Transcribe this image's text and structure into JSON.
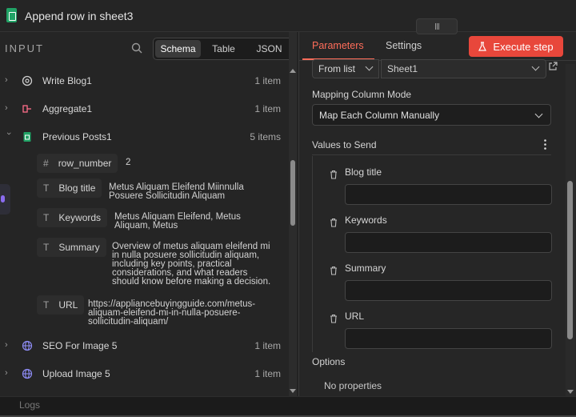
{
  "window": {
    "title": "Append row in sheet3"
  },
  "input_panel": {
    "label": "INPUT",
    "view_tabs": [
      {
        "label": "Schema",
        "active": true
      },
      {
        "label": "Table",
        "active": false
      },
      {
        "label": "JSON",
        "active": false
      }
    ],
    "nodes": [
      {
        "name": "Write Blog1",
        "count": "1 item",
        "icon": "openai-icon",
        "expanded": false
      },
      {
        "name": "Aggregate1",
        "count": "1 item",
        "icon": "aggregate-icon",
        "expanded": false
      },
      {
        "name": "Previous Posts1",
        "count": "5 items",
        "icon": "google-sheets-icon",
        "expanded": true
      },
      {
        "name": "SEO For Image 5",
        "count": "1 item",
        "icon": "globe-icon",
        "expanded": false
      },
      {
        "name": "Upload Image 5",
        "count": "1 item",
        "icon": "globe-icon",
        "expanded": false
      }
    ],
    "fields": [
      {
        "type": "#",
        "name": "row_number",
        "value": "2"
      },
      {
        "type": "T",
        "name": "Blog title",
        "value": "Metus Aliquam Eleifend Miinnulla\nPosuere Sollicitudin Aliquam"
      },
      {
        "type": "T",
        "name": "Keywords",
        "value": "Metus Aliquam Eleifend, Metus\nAliquam, Metus"
      },
      {
        "type": "T",
        "name": "Summary",
        "value": "Overview of metus aliquam eleifend mi\nin nulla posuere sollicitudin aliquam,\nincluding key points, practical\nconsiderations, and what readers\nshould know before making a decision."
      },
      {
        "type": "T",
        "name": "URL",
        "value": "https://appliancebuyingguide.com/metus-\naliquam-eleifend-mi-in-nulla-posuere-\nsollicitudin-aliquam/"
      }
    ]
  },
  "params_panel": {
    "tabs": {
      "parameters": "Parameters",
      "settings": "Settings"
    },
    "execute_label": "Execute step",
    "from_list": "From list",
    "sheet_value": "Sheet1",
    "mapping_label": "Mapping Column Mode",
    "mapping_value": "Map Each Column Manually",
    "values_to_send": "Values to Send",
    "columns": [
      {
        "label": "Blog title",
        "value": ""
      },
      {
        "label": "Keywords",
        "value": ""
      },
      {
        "label": "Summary",
        "value": ""
      },
      {
        "label": "URL",
        "value": ""
      }
    ],
    "options_label": "Options",
    "no_properties": "No properties"
  },
  "bottom": {
    "logs_label": "Logs"
  },
  "colors": {
    "accent": "#ff6d5a",
    "execute_bg": "#e8473b",
    "sheets_green": "#21a366"
  }
}
